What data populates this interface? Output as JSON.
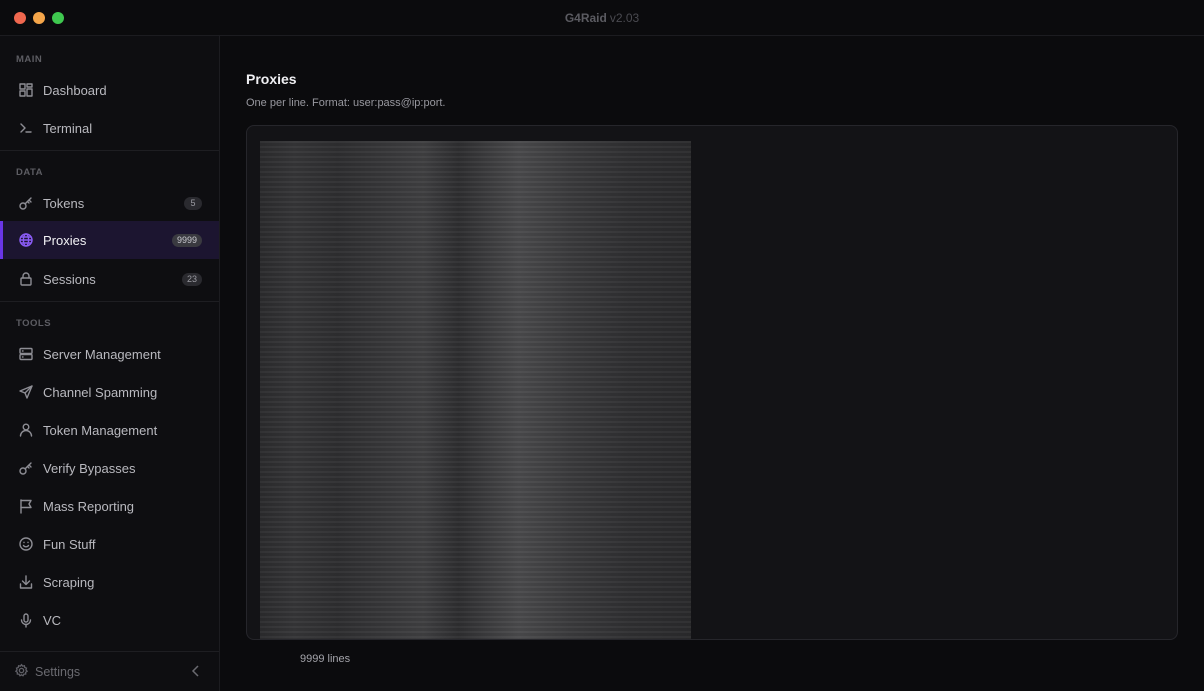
{
  "window": {
    "title": "G4Raid",
    "version": "v2.03"
  },
  "sidebar": {
    "sections": [
      {
        "label": "MAIN"
      },
      {
        "label": "DATA"
      },
      {
        "label": "TOOLS"
      }
    ],
    "main_items": [
      {
        "label": "Dashboard",
        "icon": "dashboard-icon"
      },
      {
        "label": "Terminal",
        "icon": "terminal-icon"
      }
    ],
    "data_items": [
      {
        "label": "Tokens",
        "icon": "key-icon",
        "badge": "5"
      },
      {
        "label": "Proxies",
        "icon": "globe-icon",
        "badge": "9999",
        "active": true
      },
      {
        "label": "Sessions",
        "icon": "lock-icon",
        "badge": "23"
      }
    ],
    "tool_items": [
      {
        "label": "Server Management",
        "icon": "server-icon"
      },
      {
        "label": "Channel Spamming",
        "icon": "send-icon"
      },
      {
        "label": "Token Management",
        "icon": "user-icon"
      },
      {
        "label": "Verify Bypasses",
        "icon": "key-icon"
      },
      {
        "label": "Mass Reporting",
        "icon": "flag-icon"
      },
      {
        "label": "Fun Stuff",
        "icon": "smile-icon"
      },
      {
        "label": "Scraping",
        "icon": "download-icon"
      },
      {
        "label": "VC",
        "icon": "microphone-icon"
      }
    ],
    "settings_label": "Settings"
  },
  "main": {
    "title": "Proxies",
    "subtitle": "One per line. Format: user:pass@ip:port.",
    "line_count": "9999 lines"
  },
  "colors": {
    "accent": "#6a36e6",
    "active_bg": "#1c1530"
  }
}
